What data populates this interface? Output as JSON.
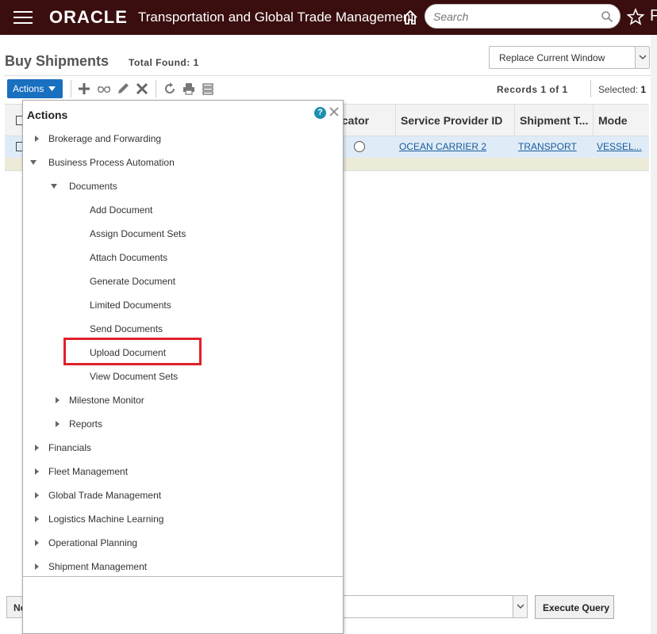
{
  "header": {
    "brand": "ORACLE",
    "app_title": "Transportation and Global Trade Management",
    "search_placeholder": "Search",
    "cut_glyph": "P"
  },
  "page": {
    "title": "Buy Shipments",
    "total_found": "Total Found: 1",
    "window_mode": "Replace Current Window"
  },
  "toolbar": {
    "actions_label": "Actions",
    "records": "Records  1  of  1",
    "selected_label": "Selected:",
    "selected_count": "1"
  },
  "table": {
    "columns": [
      "icator",
      "Service Provider ID",
      "Shipment T...",
      "Mode"
    ],
    "row": {
      "service_provider": "OCEAN CARRIER 2",
      "shipment_type": "TRANSPORT",
      "mode": "VESSEL..."
    }
  },
  "actions_popup": {
    "title": "Actions",
    "help": "?",
    "items": [
      {
        "label": "Brokerage and Forwarding",
        "state": "collapsed"
      },
      {
        "label": "Business Process Automation",
        "state": "expanded"
      },
      {
        "label": "Documents",
        "state": "expanded"
      },
      {
        "label": "Add Document",
        "state": "leaf"
      },
      {
        "label": "Assign Document Sets",
        "state": "leaf"
      },
      {
        "label": "Attach Documents",
        "state": "leaf"
      },
      {
        "label": "Generate Document",
        "state": "leaf"
      },
      {
        "label": "Limited Documents",
        "state": "leaf"
      },
      {
        "label": "Send Documents",
        "state": "leaf"
      },
      {
        "label": "Upload Document",
        "state": "leaf",
        "highlighted": true
      },
      {
        "label": "View Document Sets",
        "state": "leaf"
      },
      {
        "label": "Milestone Monitor",
        "state": "collapsed"
      },
      {
        "label": "Reports",
        "state": "collapsed"
      },
      {
        "label": "Financials",
        "state": "collapsed"
      },
      {
        "label": "Fleet Management",
        "state": "collapsed"
      },
      {
        "label": "Global Trade Management",
        "state": "collapsed"
      },
      {
        "label": "Logistics Machine Learning",
        "state": "collapsed"
      },
      {
        "label": "Operational Planning",
        "state": "collapsed"
      },
      {
        "label": "Shipment Management",
        "state": "collapsed"
      }
    ]
  },
  "bottom": {
    "left_button": "Ne",
    "execute_label": "Execute Query"
  },
  "colors": {
    "header_bg": "#3a0e0e",
    "actions_button": "#1a70c0",
    "highlight_border": "#e0202a",
    "link": "#1a5a9a",
    "selected_row": "#dfecf7"
  }
}
